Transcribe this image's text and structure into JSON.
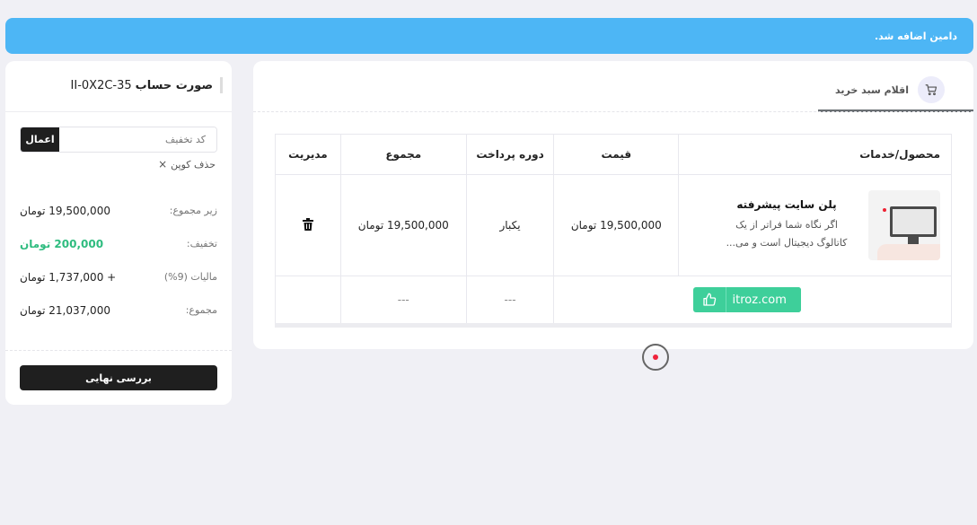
{
  "alert": {
    "text": "دامین اضافه شد."
  },
  "cart": {
    "tab_label": "اقلام سبد خرید",
    "headers": {
      "product": "محصول/خدمات",
      "price": "قیمت",
      "period": "دوره پرداخت",
      "total": "مجموع",
      "manage": "مدیریت"
    },
    "item": {
      "title": "پلن سایت پیشرفته",
      "description": "اگر نگاه شما فراتر از یک کاتالوگ دیجیتال است و می...",
      "price": "19,500,000 تومان",
      "period": "یکبار",
      "total": "19,500,000 تومان"
    },
    "domain": {
      "name": "itroz.com",
      "period": "---",
      "total": "---"
    }
  },
  "summary": {
    "title_prefix": "صورت حساب",
    "account_id": "II-0X2C-35",
    "coupon_placeholder": "کد تخفیف",
    "apply_label": "اعمال",
    "remove_coupon_label": "حذف کوپن",
    "subtotal_label": "زیر مجموع:",
    "subtotal_value": "19,500,000 تومان",
    "discount_label": "تخفیف:",
    "discount_value": "200,000 تومان",
    "tax_label": "مالیات (9%)",
    "tax_value": "+ 1,737,000 تومان",
    "total_label": "مجموع:",
    "total_value": "21,037,000 تومان",
    "checkout_label": "بررسی نهایی"
  },
  "colors": {
    "alert": "#4db6f5",
    "accent_green": "#2ebc7f",
    "domain_badge": "#3ecf9a",
    "dark_button": "#1f1f1f"
  }
}
